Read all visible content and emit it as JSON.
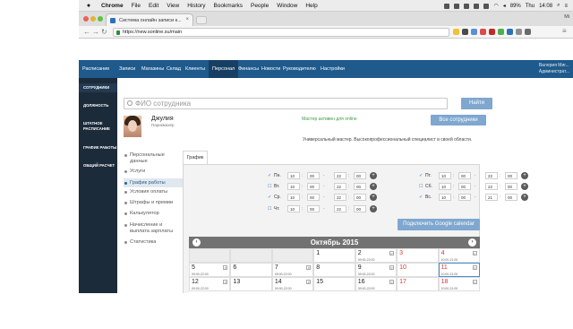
{
  "macbar": {
    "app": "Chrome",
    "menus": [
      "File",
      "Edit",
      "View",
      "History",
      "Bookmarks",
      "People",
      "Window",
      "Help"
    ],
    "battery": "89%",
    "day": "Thu",
    "time": "14:08"
  },
  "browser": {
    "tab_title": "Система онлайн записи к...",
    "url": "https://new.sonline.su/main",
    "profile": "Mi"
  },
  "nav": {
    "items": [
      "Расписание",
      "Записи",
      "Магазины",
      "Склад",
      "Клиенты",
      "Персонал",
      "Финансы",
      "Новости",
      "Руководителю",
      "Настройки"
    ],
    "active": "Персонал",
    "user_line1": "Валерия Миг...",
    "user_line2": "Администрат..."
  },
  "sidebar": {
    "items": [
      "СОТРУДНИКИ",
      "ДОЛЖНОСТЬ",
      "ШТАТНОЕ",
      "РАСПИСАНИЕ",
      "ГРАФИК РАБОТЫ",
      "ОБЩИЙ РАСЧЕТ"
    ]
  },
  "search": {
    "placeholder": "ФИО сотрудника",
    "button": "Найти"
  },
  "employee": {
    "name": "Джулия",
    "role": "Парикмахер",
    "status": "Мастер активен для online",
    "all_button": "Все сотрудники",
    "description": "Универсальный мастер. Высокопрофессиональный специалист в своей области."
  },
  "settings_menu": {
    "items": [
      "Персональные",
      "данные",
      "Услуги",
      "График работы",
      "Условия оплаты",
      "Штрафы и премии",
      "Калькулятор",
      "Начисление и",
      "выплата зарплаты",
      "Статистика"
    ]
  },
  "schedule": {
    "tab": "График",
    "left": [
      {
        "day": "Пн.",
        "checked": true,
        "h1": "10",
        "m1": "00",
        "h2": "22",
        "m2": "00"
      },
      {
        "day": "Вт.",
        "checked": false,
        "h1": "10",
        "m1": "00",
        "h2": "22",
        "m2": "00"
      },
      {
        "day": "Ср.",
        "checked": true,
        "h1": "10",
        "m1": "00",
        "h2": "22",
        "m2": "00"
      },
      {
        "day": "Чт.",
        "checked": false,
        "h1": "10",
        "m1": "00",
        "h2": "22",
        "m2": "00"
      }
    ],
    "right": [
      {
        "day": "Пт.",
        "checked": true,
        "h1": "10",
        "m1": "00",
        "h2": "22",
        "m2": "00"
      },
      {
        "day": "Сб.",
        "checked": false,
        "h1": "10",
        "m1": "00",
        "h2": "22",
        "m2": "00"
      },
      {
        "day": "Вс.",
        "checked": true,
        "h1": "10",
        "m1": "00",
        "h2": "21",
        "m2": "00"
      }
    ],
    "google_button": "Подключить Google calendar"
  },
  "calendar": {
    "month": "Октябрь 2015",
    "prev": "‹",
    "next": "›",
    "row1": [
      {
        "num": "",
        "time": ""
      },
      {
        "num": "",
        "time": ""
      },
      {
        "num": "",
        "time": ""
      },
      {
        "num": "1",
        "time": ""
      },
      {
        "num": "2",
        "time": "09:00-22:00"
      },
      {
        "num": "3",
        "time": ""
      },
      {
        "num": "4",
        "time": "10:00-21:00"
      }
    ],
    "row2": [
      {
        "num": "5",
        "time": "09:00-22:00"
      },
      {
        "num": "6",
        "time": ""
      },
      {
        "num": "7",
        "time": "09:00-22:00"
      },
      {
        "num": "8",
        "time": ""
      },
      {
        "num": "9",
        "time": "09:00-22:00"
      },
      {
        "num": "10",
        "time": ""
      },
      {
        "num": "11",
        "time": "10:00-21:00"
      }
    ],
    "row3": [
      {
        "num": "12",
        "time": "09:00-22:00"
      },
      {
        "num": "13",
        "time": ""
      },
      {
        "num": "14",
        "time": "09:00-22:00"
      },
      {
        "num": "15",
        "time": ""
      },
      {
        "num": "16",
        "time": "09:00-22:00"
      },
      {
        "num": "17",
        "time": ""
      },
      {
        "num": "18",
        "time": "10:00-21:00"
      }
    ]
  }
}
